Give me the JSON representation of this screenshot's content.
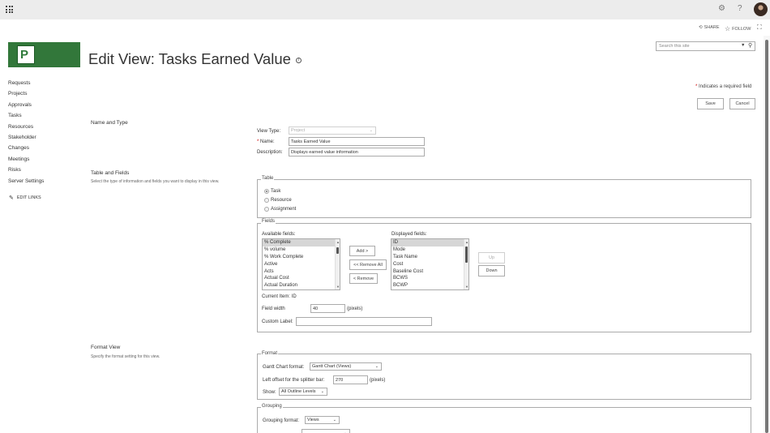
{
  "suite_bar": {
    "settings_icon": "gear-icon",
    "help_icon": "question-icon",
    "app_launcher_icon": "waffle-icon"
  },
  "action_bar": {
    "share": "SHARE",
    "follow": "FOLLOW"
  },
  "search": {
    "placeholder": "Search this site"
  },
  "page": {
    "title": "Edit View: Tasks Earned Value"
  },
  "left_nav": {
    "items": [
      "Requests",
      "Projects",
      "Approvals",
      "Tasks",
      "Resources",
      "Stakeholder",
      "Changes",
      "Meetings",
      "Risks",
      "Server Settings"
    ],
    "edit_links": "EDIT LINKS"
  },
  "required_note": "Indicates a required field",
  "buttons": {
    "save": "Save",
    "cancel": "Cancel"
  },
  "name_and_type": {
    "title": "Name and Type",
    "view_type_label": "View Type:",
    "view_type_value": "Project",
    "name_label": "Name:",
    "name_value": "Tasks Earned Value",
    "description_label": "Description:",
    "description_value": "Displays earned value information"
  },
  "table_and_fields": {
    "title": "Table and Fields",
    "description": "Select the type of information and fields you want to display in this view.",
    "table_legend": "Table",
    "table_options": [
      "Task",
      "Resource",
      "Assignment"
    ],
    "table_selected": "Task",
    "fields_legend": "Fields",
    "available_label": "Available fields:",
    "available_fields": [
      "% Complete",
      "% volume",
      "% Work Complete",
      "Active",
      "Acts",
      "Actual Cost",
      "Actual Duration"
    ],
    "displayed_label": "Displayed fields:",
    "displayed_fields": [
      "ID",
      "Mode",
      "Task Name",
      "Cost",
      "Baseline Cost",
      "BCWS",
      "BCWP"
    ],
    "add_button": "Add >",
    "remove_all_button": "<< Remove All",
    "remove_button": "< Remove",
    "up_button": "Up",
    "down_button": "Down",
    "current_item": "Current Item: ID",
    "field_width_label": "Field width",
    "field_width_value": "40",
    "field_width_unit": "(pixels)",
    "custom_label_label": "Custom Label:",
    "custom_label_value": ""
  },
  "format_view": {
    "title": "Format View",
    "description": "Specify the format setting for this view.",
    "format_legend": "Format",
    "gantt_label": "Gantt Chart format:",
    "gantt_value": "Gantt Chart (Views)",
    "splitter_label": "Left offset for the splitter bar:",
    "splitter_value": "270",
    "splitter_unit": "(pixels)",
    "show_label": "Show:",
    "show_value": "All Outline Levels",
    "grouping_legend": "Grouping",
    "grouping_label": "Grouping format:",
    "grouping_value": "Views"
  }
}
